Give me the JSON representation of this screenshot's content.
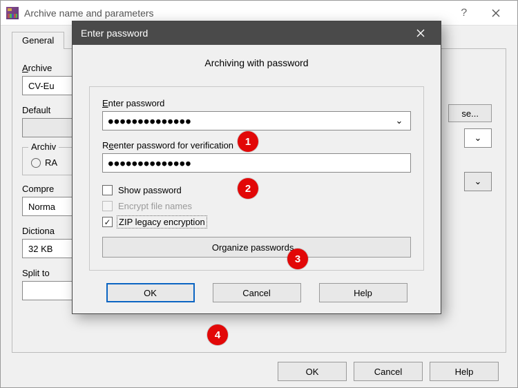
{
  "outer": {
    "title": "Archive name and parameters",
    "tab_general": "General",
    "archive_name_label": "Archive name",
    "archive_name_value": "CV-Eu",
    "browse": "se...",
    "default_profile_label": "Default",
    "archive_format_legend": "Archiv",
    "rar_option": "RA",
    "compression_label": "Compre",
    "compression_value": "Norma",
    "dictionary_label": "Dictiona",
    "dictionary_value": "32 KB",
    "split_label": "Split to",
    "ok": "OK",
    "cancel": "Cancel",
    "help": "Help"
  },
  "dialog": {
    "title": "Enter password",
    "heading": "Archiving with password",
    "enter_password_label": "Enter password",
    "password_masked": "●●●●●●●●●●●●●●",
    "reenter_label": "Reenter password for verification",
    "reenter_masked": "●●●●●●●●●●●●●●",
    "show_password": "Show password",
    "encrypt_filenames": "Encrypt file names",
    "zip_legacy": "ZIP legacy encryption",
    "organize": "Organize passwords...",
    "ok": "OK",
    "cancel": "Cancel",
    "help": "Help"
  },
  "callouts": {
    "c1": "1",
    "c2": "2",
    "c3": "3",
    "c4": "4"
  }
}
